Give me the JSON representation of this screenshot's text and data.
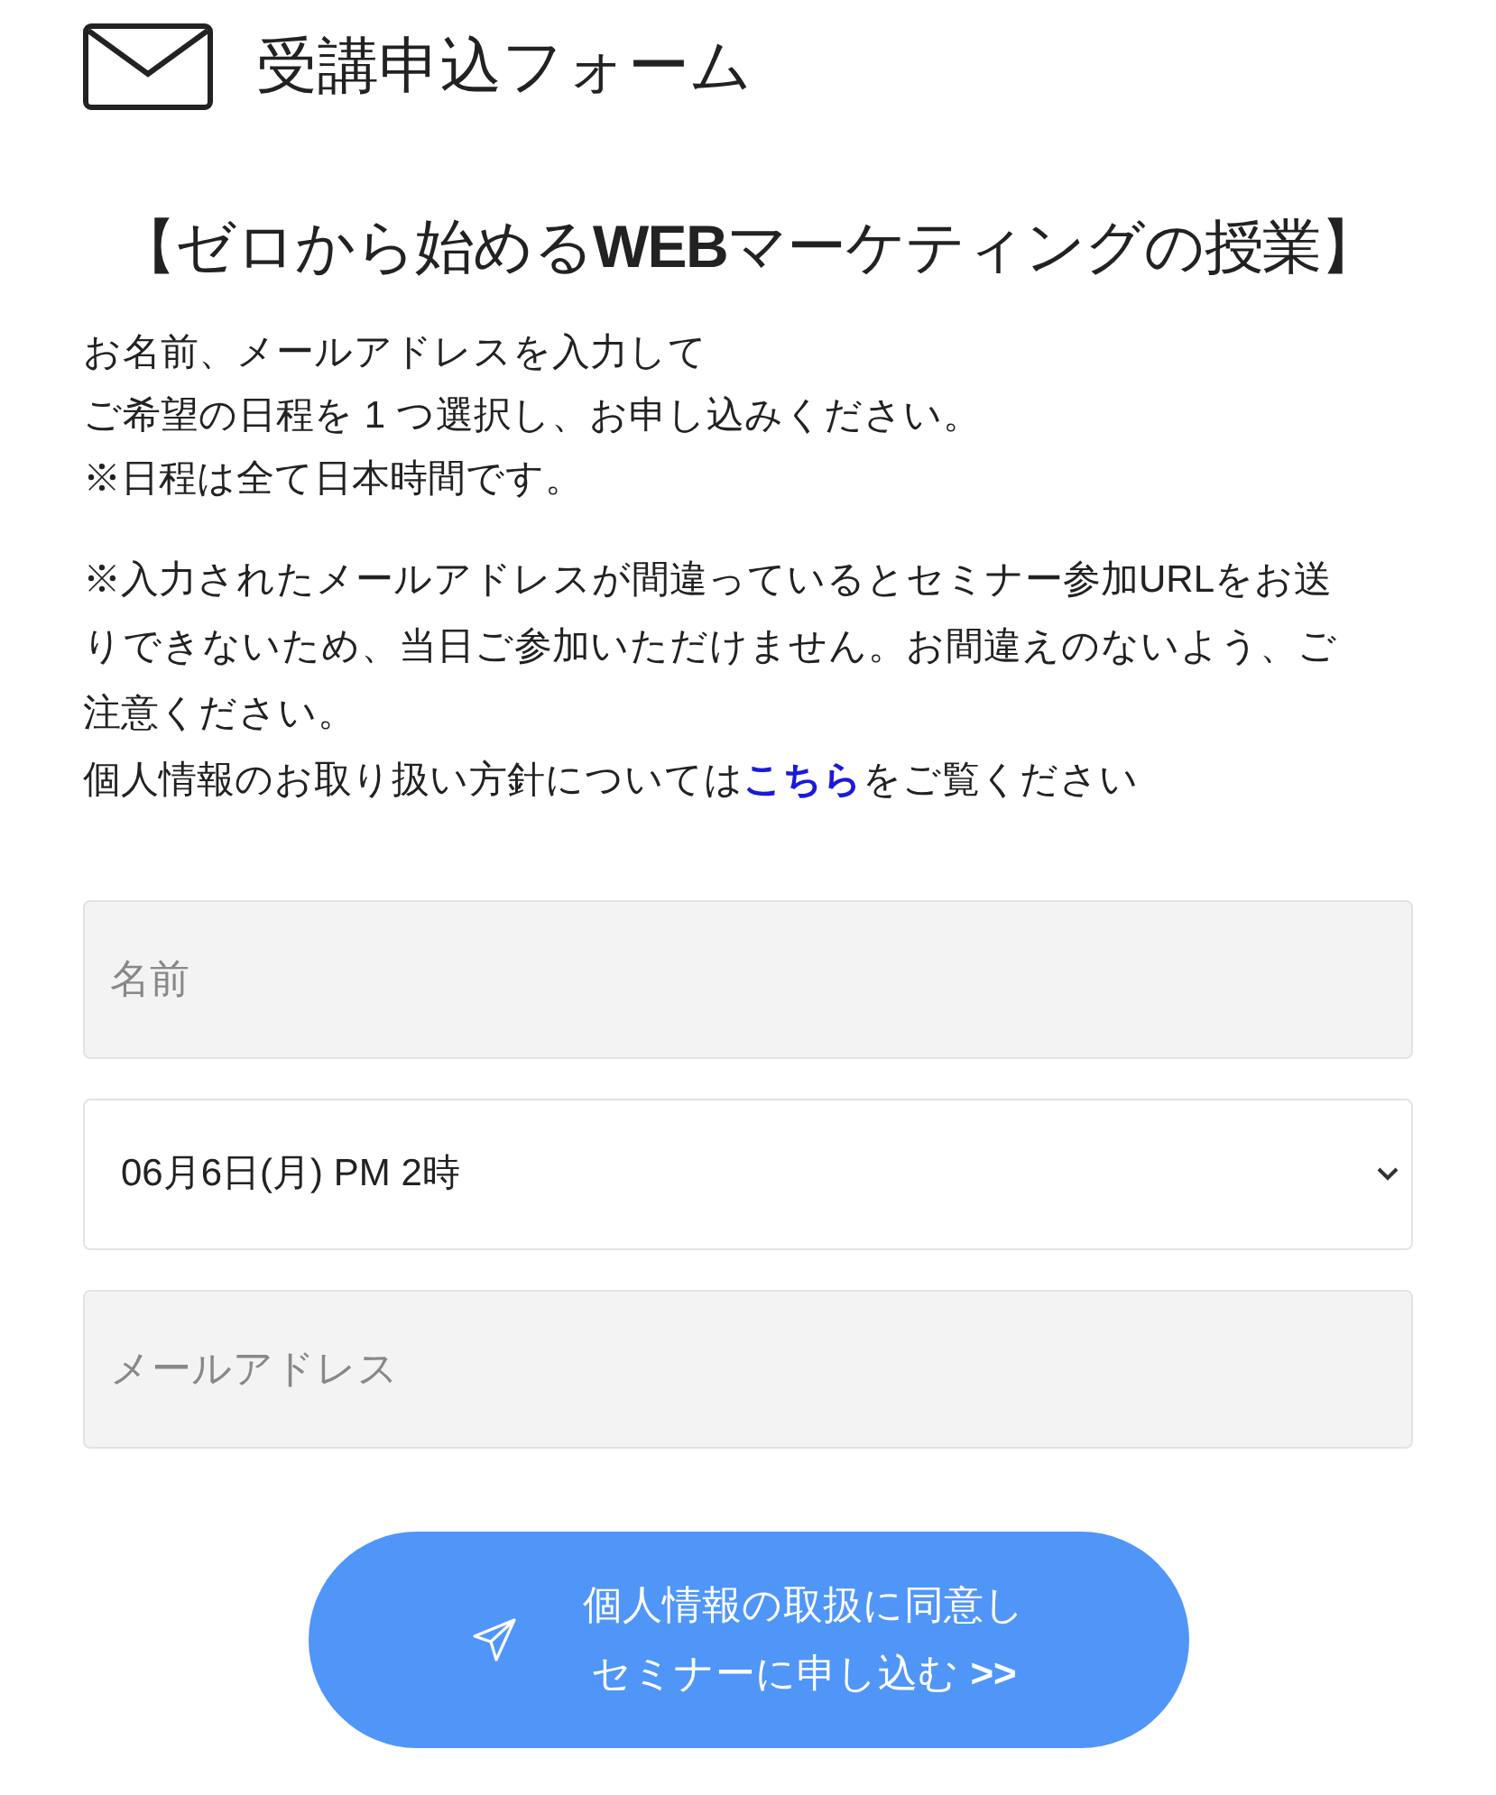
{
  "header": {
    "title": "受講申込フォーム"
  },
  "heading": "【ゼロから始める**WEB**マーケティングの授業】",
  "intro_lines": [
    "お名前、メールアドレスを入力して",
    "ご希望の日程を 1 つ選択し、お申し込みください。",
    "※日程は全て日本時間です。"
  ],
  "notice": "※入力されたメールアドレスが間違っているとセミナー参加URLをお送りできないため、当日ご参加いただけません。お間違えのないよう、ご注意ください。",
  "privacy": {
    "before": "個人情報のお取り扱い方針については",
    "link": "こちら",
    "after": "をご覧ください"
  },
  "fields": [
    {
      "kind": "text",
      "placeholder": "名前"
    },
    {
      "kind": "select",
      "value": "06月6日(月) PM 2時"
    },
    {
      "kind": "text",
      "placeholder": "メールアドレス"
    }
  ],
  "submit": {
    "lines": [
      "個人情報の取扱に同意し",
      "セミナーに申し込む **>>**"
    ]
  }
}
